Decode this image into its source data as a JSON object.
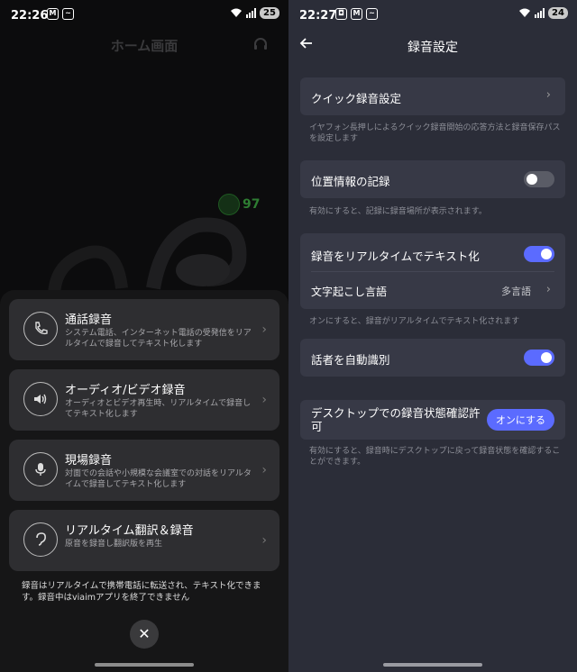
{
  "left": {
    "status": {
      "time": "22:26",
      "battery": "25"
    },
    "home_title": "ホーム画面",
    "battery_percent": "97",
    "cards": [
      {
        "icon": "phone-call-icon",
        "title": "通話録音",
        "desc": "システム電話、インターネット電話の受発信をリアルタイムで録音してテキスト化します"
      },
      {
        "icon": "speaker-icon",
        "title": "オーディオ/ビデオ録音",
        "desc": "オーディオとビデオ再生時、リアルタイムで録音してテキスト化します"
      },
      {
        "icon": "microphone-icon",
        "title": "現場録音",
        "desc": "対面での会話や小規模な会議室での対話をリアルタイムで録音してテキスト化します"
      },
      {
        "icon": "ear-translate-icon",
        "title": "リアルタイム翻訳＆録音",
        "desc": "原音を録音し翻訳版を再生"
      }
    ],
    "note": "録音はリアルタイムで携帯電話に転送され、テキスト化できます。録音中はviaimアプリを終了できません"
  },
  "right": {
    "status": {
      "time": "22:27",
      "battery": "24"
    },
    "title": "録音設定",
    "quick": {
      "label": "クイック録音設定",
      "desc": "イヤフォン長押しによるクイック録音開始の応答方法と録音保存パスを設定します"
    },
    "location": {
      "label": "位置情報の記録",
      "desc": "有効にすると、記録に録音場所が表示されます。",
      "state": "off"
    },
    "realtime": {
      "label": "録音をリアルタイムでテキスト化",
      "state": "on",
      "lang_label": "文字起こし言語",
      "lang_value": "多言語",
      "desc": "オンにすると、録音がリアルタイムでテキスト化されます"
    },
    "speaker": {
      "label": "話者を自動識別",
      "state": "on"
    },
    "desktop": {
      "label": "デスクトップでの録音状態確認許可",
      "button": "オンにする",
      "desc": "有効にすると、録音時にデスクトップに戻って録音状態を確認することができます。"
    }
  },
  "colors": {
    "accent": "#5b6bff",
    "green": "#2e7d32"
  }
}
